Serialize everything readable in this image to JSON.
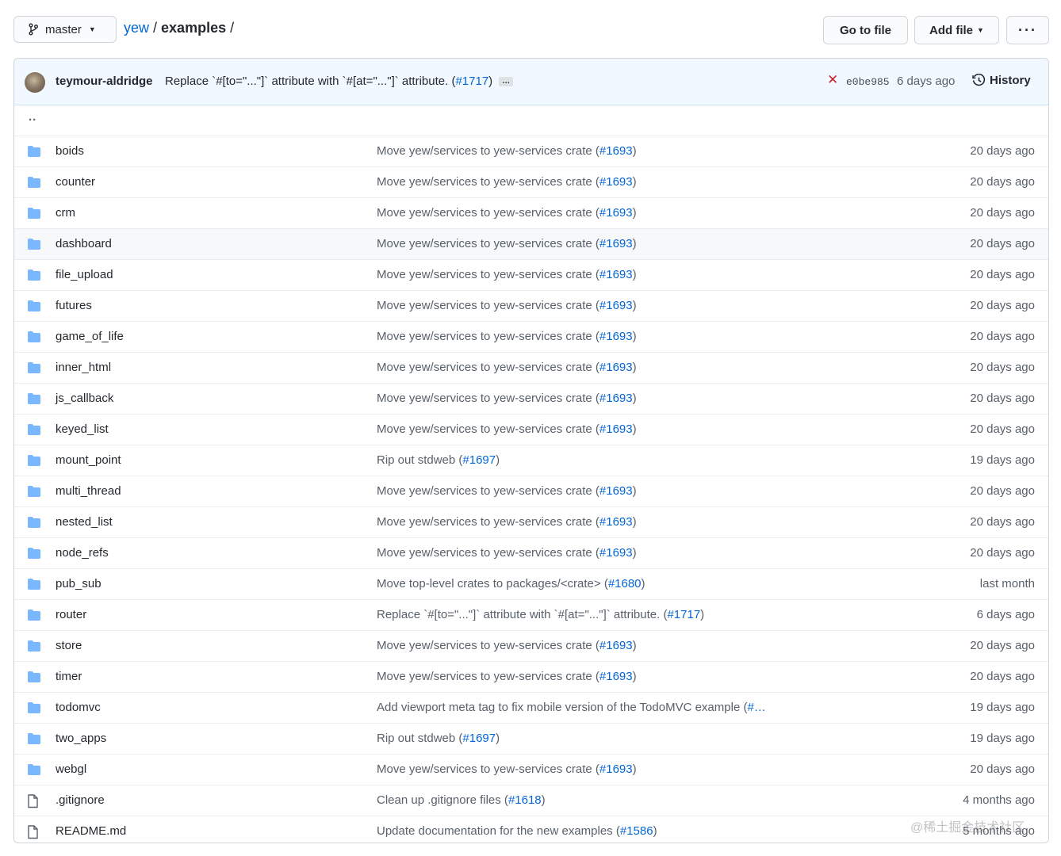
{
  "header": {
    "branch": "master",
    "breadcrumb_repo": "yew",
    "breadcrumb_sep": "/",
    "breadcrumb_dir": "examples",
    "go_to_file": "Go to file",
    "add_file": "Add file",
    "more": "···"
  },
  "commit": {
    "author": "teymour-aldridge",
    "message_prefix": "Replace `#[to=\"...\"]` attribute with `#[at=\"...\"]` attribute. (",
    "pr": "#1717",
    "message_suffix": ")",
    "expand": "…",
    "status_icon": "x-icon",
    "sha": "e0be985",
    "date": "6 days ago",
    "history": "History"
  },
  "parent": "..",
  "entries": [
    {
      "type": "dir",
      "name": "boids",
      "msg": "Move yew/services to yew-services crate (",
      "pr": "#1693",
      "suffix": ")",
      "age": "20 days ago"
    },
    {
      "type": "dir",
      "name": "counter",
      "msg": "Move yew/services to yew-services crate (",
      "pr": "#1693",
      "suffix": ")",
      "age": "20 days ago"
    },
    {
      "type": "dir",
      "name": "crm",
      "msg": "Move yew/services to yew-services crate (",
      "pr": "#1693",
      "suffix": ")",
      "age": "20 days ago"
    },
    {
      "type": "dir",
      "name": "dashboard",
      "msg": "Move yew/services to yew-services crate (",
      "pr": "#1693",
      "suffix": ")",
      "age": "20 days ago"
    },
    {
      "type": "dir",
      "name": "file_upload",
      "msg": "Move yew/services to yew-services crate (",
      "pr": "#1693",
      "suffix": ")",
      "age": "20 days ago"
    },
    {
      "type": "dir",
      "name": "futures",
      "msg": "Move yew/services to yew-services crate (",
      "pr": "#1693",
      "suffix": ")",
      "age": "20 days ago"
    },
    {
      "type": "dir",
      "name": "game_of_life",
      "msg": "Move yew/services to yew-services crate (",
      "pr": "#1693",
      "suffix": ")",
      "age": "20 days ago"
    },
    {
      "type": "dir",
      "name": "inner_html",
      "msg": "Move yew/services to yew-services crate (",
      "pr": "#1693",
      "suffix": ")",
      "age": "20 days ago"
    },
    {
      "type": "dir",
      "name": "js_callback",
      "msg": "Move yew/services to yew-services crate (",
      "pr": "#1693",
      "suffix": ")",
      "age": "20 days ago"
    },
    {
      "type": "dir",
      "name": "keyed_list",
      "msg": "Move yew/services to yew-services crate (",
      "pr": "#1693",
      "suffix": ")",
      "age": "20 days ago"
    },
    {
      "type": "dir",
      "name": "mount_point",
      "msg": "Rip out stdweb (",
      "pr": "#1697",
      "suffix": ")",
      "age": "19 days ago"
    },
    {
      "type": "dir",
      "name": "multi_thread",
      "msg": "Move yew/services to yew-services crate (",
      "pr": "#1693",
      "suffix": ")",
      "age": "20 days ago"
    },
    {
      "type": "dir",
      "name": "nested_list",
      "msg": "Move yew/services to yew-services crate (",
      "pr": "#1693",
      "suffix": ")",
      "age": "20 days ago"
    },
    {
      "type": "dir",
      "name": "node_refs",
      "msg": "Move yew/services to yew-services crate (",
      "pr": "#1693",
      "suffix": ")",
      "age": "20 days ago"
    },
    {
      "type": "dir",
      "name": "pub_sub",
      "msg": "Move top-level crates to packages/<crate> (",
      "pr": "#1680",
      "suffix": ")",
      "age": "last month"
    },
    {
      "type": "dir",
      "name": "router",
      "msg": "Replace `#[to=\"...\"]` attribute with `#[at=\"...\"]` attribute. (",
      "pr": "#1717",
      "suffix": ")",
      "age": "6 days ago"
    },
    {
      "type": "dir",
      "name": "store",
      "msg": "Move yew/services to yew-services crate (",
      "pr": "#1693",
      "suffix": ")",
      "age": "20 days ago"
    },
    {
      "type": "dir",
      "name": "timer",
      "msg": "Move yew/services to yew-services crate (",
      "pr": "#1693",
      "suffix": ")",
      "age": "20 days ago"
    },
    {
      "type": "dir",
      "name": "todomvc",
      "msg": "Add viewport meta tag to fix mobile version of the TodoMVC example (",
      "pr": "#…",
      "suffix": "",
      "age": "19 days ago"
    },
    {
      "type": "dir",
      "name": "two_apps",
      "msg": "Rip out stdweb (",
      "pr": "#1697",
      "suffix": ")",
      "age": "19 days ago"
    },
    {
      "type": "dir",
      "name": "webgl",
      "msg": "Move yew/services to yew-services crate (",
      "pr": "#1693",
      "suffix": ")",
      "age": "20 days ago"
    },
    {
      "type": "file",
      "name": ".gitignore",
      "msg": "Clean up .gitignore files (",
      "pr": "#1618",
      "suffix": ")",
      "age": "4 months ago"
    },
    {
      "type": "file",
      "name": "README.md",
      "msg": "Update documentation for the new examples (",
      "pr": "#1586",
      "suffix": ")",
      "age": "5 months ago"
    }
  ],
  "highlighted_row": "dashboard",
  "watermark": "@稀土掘金技术社区",
  "colors": {
    "link": "#0366d6",
    "folder": "#79b8ff",
    "commit_bg": "#f1f8ff",
    "error": "#cb2431"
  }
}
